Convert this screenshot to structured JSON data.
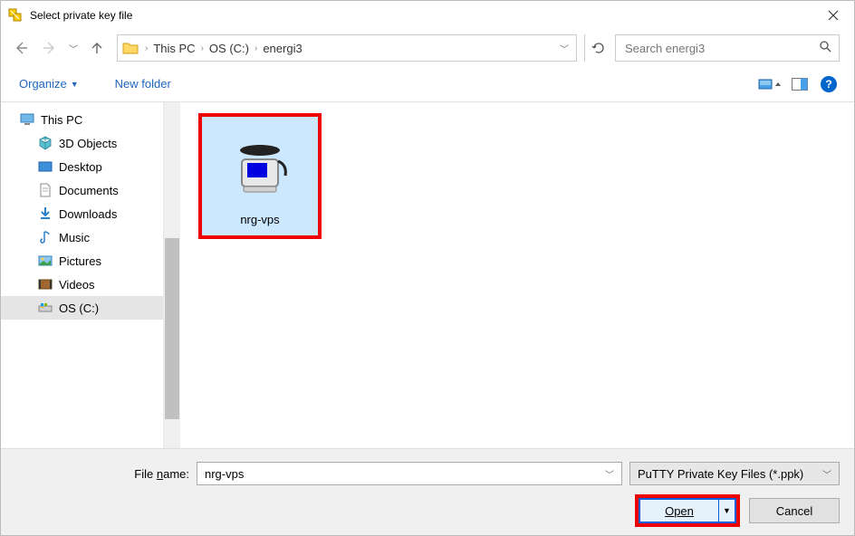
{
  "title": "Select private key file",
  "breadcrumbs": [
    "This PC",
    "OS (C:)",
    "energi3"
  ],
  "search_placeholder": "Search energi3",
  "toolbar": {
    "organize": "Organize",
    "new_folder": "New folder"
  },
  "sidebar": {
    "root": "This PC",
    "items": [
      {
        "label": "3D Objects"
      },
      {
        "label": "Desktop"
      },
      {
        "label": "Documents"
      },
      {
        "label": "Downloads"
      },
      {
        "label": "Music"
      },
      {
        "label": "Pictures"
      },
      {
        "label": "Videos"
      },
      {
        "label": "OS (C:)",
        "selected": true
      }
    ]
  },
  "content": {
    "file": {
      "name": "nrg-vps"
    }
  },
  "footer": {
    "filename_label": "File name:",
    "filename_value": "nrg-vps",
    "filetype": "PuTTY Private Key Files (*.ppk)",
    "open": "Open",
    "cancel": "Cancel"
  }
}
